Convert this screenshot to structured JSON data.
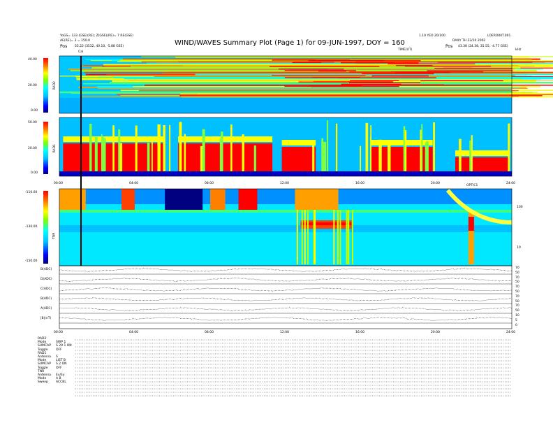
{
  "header": {
    "title": "WIND/WAVES Summary Plot (Page 1) for 09-JUN-1997, DOY = 160",
    "left_line1": "YoGS= 133 (GSE)(RE); Z(GSE)(RE)= 7 RE(GSE)",
    "left_line2": "AE(RE)= 3 = 150.0",
    "left_line3_label": "Pos",
    "left_line3_value": "55.22 (3532, 40.10, -5.88 GSE)",
    "right_line1_a": "1.10 YEO 20/100",
    "right_line1_b": "LOERO00T.001",
    "right_line2": "DAILY TH 23/10 2002",
    "right_line3_label": "Pos",
    "right_line3_value": "43.38 (24.38, 35.55, -4.77 GSE)",
    "cal_label": "Cal",
    "time_tag": "TIME(UT)",
    "khz_tag": "kHz"
  },
  "chart_data": [
    {
      "type": "heatmap",
      "name": "RAD2",
      "ylabel": "RAD2",
      "colorbar_ticks": [
        "40.00",
        "20.00",
        "0.00"
      ],
      "description_values": "intensity dB above background"
    },
    {
      "type": "heatmap",
      "name": "RAD1",
      "ylabel": "RAD1",
      "colorbar_ticks": [
        "50.00",
        "20.00",
        "0.00"
      ],
      "x_ticks": [
        "00:00",
        "04:00",
        "08:00",
        "12:00",
        "16:00",
        "20:00",
        "24:00"
      ],
      "x_range": [
        0,
        24
      ]
    },
    {
      "type": "heatmap",
      "name": "TNR",
      "ylabel": "TNR",
      "colorbar_ticks": [
        "-110.00",
        "-130.00",
        "-150.00"
      ],
      "right_axis_ticks": [
        "100",
        "10"
      ],
      "marker_label": "OPTIC1",
      "x_range": [
        0,
        24
      ]
    },
    {
      "type": "line",
      "name": "housekeeping",
      "series": [
        {
          "name": "B(ADC)"
        },
        {
          "name": "D(ADC)"
        },
        {
          "name": "C(ADC)"
        },
        {
          "name": "B(ADC)"
        },
        {
          "name": "A(ADC)"
        },
        {
          "name": "|B|(nT)"
        }
      ],
      "right_ticks": [
        "70",
        "50",
        "70",
        "50",
        "70",
        "50",
        "70",
        "50",
        "70",
        "50",
        "10",
        "5",
        "0"
      ],
      "x_ticks": [
        "00:00",
        "04:00",
        "08:00",
        "12:00",
        "16:00",
        "20:00",
        "24:00"
      ],
      "x_range": [
        0,
        24
      ]
    }
  ],
  "status": {
    "blocks": [
      {
        "lines": [
          [
            "RAD2",
            ""
          ],
          [
            "Mode",
            "SWP 1"
          ],
          [
            "SUMCAP",
            "S 29 1 ON"
          ],
          [
            "Toggle",
            "OFF"
          ]
        ]
      },
      {
        "lines": [
          [
            "RAD1",
            ""
          ],
          [
            "Antenna",
            "S"
          ],
          [
            "Mode",
            "LIST B"
          ],
          [
            "SUMCAP",
            "S 2 ON"
          ],
          [
            "Toggle",
            "OFF"
          ]
        ]
      },
      {
        "lines": [
          [
            "TNR",
            ""
          ],
          [
            "Antenna",
            "Ex/Ey"
          ],
          [
            "Mode",
            "A B"
          ],
          [
            "Sweep",
            "ACCBL"
          ]
        ]
      }
    ]
  },
  "colors": {
    "scale": [
      "#000080",
      "#0000ff",
      "#0080ff",
      "#00c0ff",
      "#00ffff",
      "#40ff80",
      "#c0ff00",
      "#ffff00",
      "#ffa000",
      "#ff4000",
      "#ff0000"
    ]
  }
}
